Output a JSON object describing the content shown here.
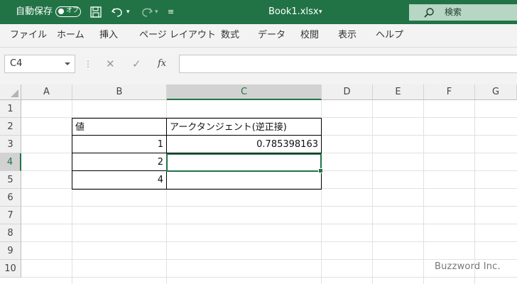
{
  "titlebar": {
    "autosave_label": "自動保存",
    "autosave_state": "オフ",
    "filename": "Book1.xlsx",
    "search_label": "検索"
  },
  "ribbon": {
    "tabs": [
      "ファイル",
      "ホーム",
      "挿入",
      "ページ レイアウト",
      "数式",
      "データ",
      "校閲",
      "表示",
      "ヘルプ"
    ]
  },
  "formula_bar": {
    "name_box": "C4",
    "fx_label": "fx",
    "content": ""
  },
  "sheet": {
    "columns": [
      "A",
      "B",
      "C",
      "D",
      "E",
      "F",
      "G"
    ],
    "selected_column": "C",
    "rows": [
      "1",
      "2",
      "3",
      "4",
      "5",
      "6",
      "7",
      "8",
      "9",
      "10"
    ],
    "selected_row": "4",
    "cells": {
      "B2": "値",
      "C2": "アークタンジェント(逆正接)",
      "B3": "1",
      "C3": "0.785398163",
      "B4": "2",
      "C4": "",
      "B5": "4",
      "C5": ""
    }
  },
  "watermark": "Buzzword Inc.",
  "colors": {
    "accent": "#217346",
    "search_bg": "#b7d6c4"
  }
}
